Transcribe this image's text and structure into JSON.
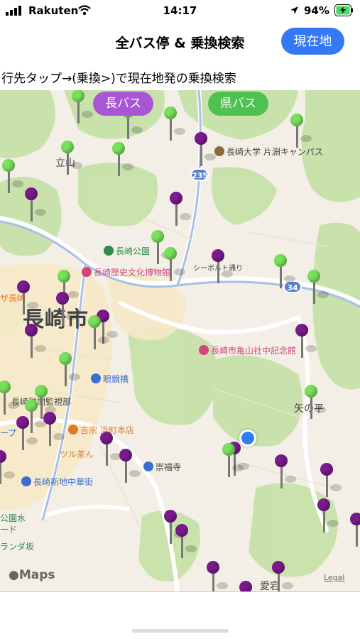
{
  "status_bar": {
    "carrier": "Rakuten",
    "time": "14:17",
    "battery": "94%"
  },
  "nav": {
    "title": "全バス停 & 乗換検索",
    "current_location_button": "現在地"
  },
  "instruction": "行先タップ→(乗換>)で現在地発の乗換検索",
  "map": {
    "toggles": {
      "nagasaki_bus": "長バス",
      "ken_bus": "県バス"
    },
    "labels": {
      "tateyama": "立山",
      "university": "長崎大学 片淵キャンパス",
      "park": "長崎公園",
      "museum": "長崎歴史文化博物館",
      "siebold": "シーボルト通り",
      "city": "長崎市",
      "kameyama": "長崎市亀山社中記念館",
      "meganebashi": "眼鏡橋",
      "yanohira": "矢の平",
      "tax": "長崎税関監視部",
      "yoshimune": "吉宗 浜町本店",
      "tsuru": "ツル茶ん",
      "sofukuji": "崇福寺",
      "chinatown": "長崎新地中華街",
      "atago": "愛宕",
      "left_park": "公園水",
      "left_do": "ード",
      "left_oranda": "ランダ坂",
      "left_zaga": "ザ長崎",
      "left_pu": "ープ"
    },
    "routes": [
      "235",
      "34"
    ],
    "colors": {
      "nagasaki_bus_pin": "#7a1a8c",
      "ken_bus_pin": "#79e05c",
      "user_location": "#2f7df6",
      "accent": "#3478f6"
    },
    "attribution": "Maps",
    "legal": "Legal"
  }
}
